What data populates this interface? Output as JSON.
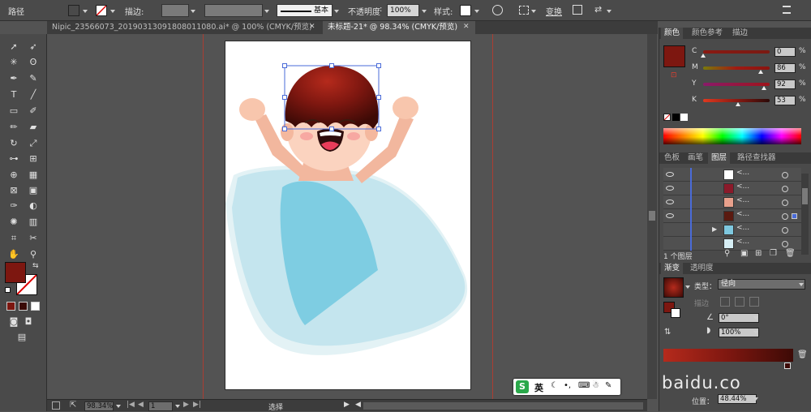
{
  "control_bar": {
    "object_type": "路径",
    "stroke_label": "描边",
    "stroke_style": "基本",
    "opacity_label": "不透明度",
    "opacity_value": "100%",
    "style_label": "样式",
    "transform_label": "变换",
    "fill_color": "#8b1a10"
  },
  "tabs": [
    {
      "label": "Nipic_23566073_20190313091808011080.ai* @ 100% (CMYK/预览)",
      "active": false
    },
    {
      "label": "未标题-21* @ 98.34% (CMYK/预览)",
      "active": true
    }
  ],
  "color_panel": {
    "tabs": [
      "颜色",
      "颜色参考",
      "描边"
    ],
    "channels": [
      {
        "name": "C",
        "value": "0",
        "fraction": 0.0,
        "track": "linear-gradient(90deg,#8a1a12,#7a1a12)"
      },
      {
        "name": "M",
        "value": "86",
        "fraction": 0.86,
        "track": "linear-gradient(90deg,#7a7a0a,#a01a12,#8a1410)"
      },
      {
        "name": "Y",
        "value": "92",
        "fraction": 0.92,
        "track": "linear-gradient(90deg,#8a1a6a,#a0141a)"
      },
      {
        "name": "K",
        "value": "53",
        "fraction": 0.53,
        "track": "linear-gradient(90deg,#e0391f,#8a1a12,#2a0a08)"
      }
    ],
    "color": "#7d1710"
  },
  "layers_panel": {
    "tabs": [
      "色板",
      "画笔",
      "图层",
      "路径查找器"
    ],
    "rows": [
      {
        "name": "<...",
        "thumb": "#ffffff"
      },
      {
        "name": "<...",
        "thumb": "#8b1a2a"
      },
      {
        "name": "<...",
        "thumb": "#e8a08c"
      },
      {
        "name": "<...",
        "thumb": "#5a1a10"
      },
      {
        "name": "<...",
        "thumb": "#7ec8df"
      },
      {
        "name": "<...",
        "thumb": "#d6eef4"
      }
    ],
    "footer": "1 个图层"
  },
  "gradient_panel": {
    "tabs": [
      "渐变",
      "透明度"
    ],
    "type_label": "类型：",
    "type_value": "径向",
    "stroke_label": "描边",
    "angle_value": "0°",
    "aspect_value": "100%",
    "location_label": "位置：",
    "location_value": "48.44%"
  },
  "status_bar": {
    "zoom": "98.34%",
    "artboard": "1",
    "tool": "选择"
  },
  "ime": {
    "logo": "S",
    "lang": "英"
  },
  "watermark": "baidu.co"
}
